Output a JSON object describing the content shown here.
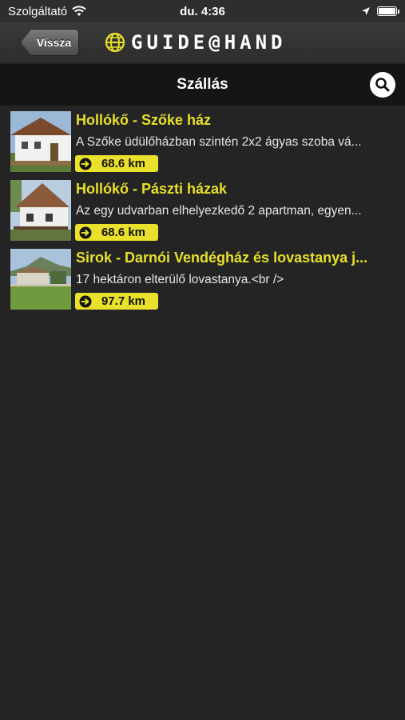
{
  "status_bar": {
    "carrier": "Szolgáltató",
    "time": "du. 4:36"
  },
  "header": {
    "back_label": "Vissza",
    "logo_text": "GUIDE@HAND"
  },
  "title_bar": {
    "title": "Szállás"
  },
  "items": [
    {
      "title": "Hollókő - Szőke ház",
      "description": "A Szőke üdülőházban szintén 2x2 ágyas szoba vá...",
      "distance": "68.6 km"
    },
    {
      "title": "Hollókő - Pászti házak",
      "description": "Az egy udvarban elhelyezkedő 2 apartman, egyen...",
      "distance": "68.6 km"
    },
    {
      "title": "Sirok - Darnói Vendégház és lovastanya j...",
      "description": "17 hektáron elterülő lovastanya.<br />",
      "distance": "97.7 km"
    }
  ],
  "colors": {
    "accent": "#e9e12b",
    "background": "#242424",
    "title_bar": "#151515"
  }
}
